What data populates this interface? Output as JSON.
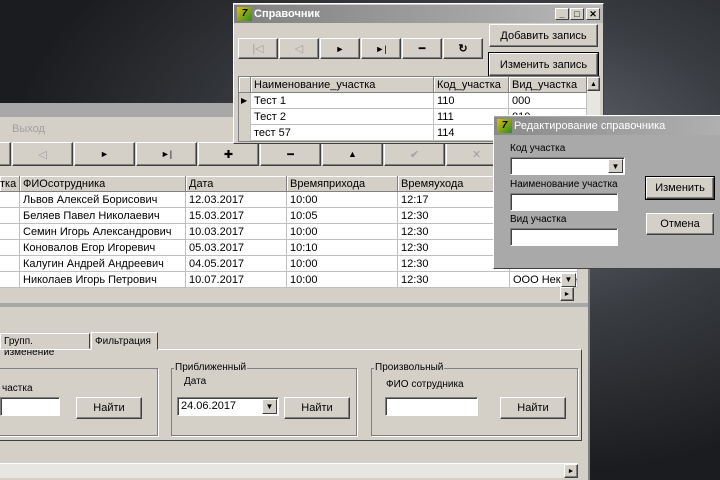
{
  "main": {
    "menu": {
      "items": [
        "Выход"
      ]
    },
    "toolbar": {
      "icons": [
        "prior-icon",
        "next-icon",
        "last-icon",
        "insert-icon",
        "delete-icon",
        "edit-icon",
        "post-icon",
        "cancel-icon"
      ],
      "glyphs": [
        "◁",
        "►",
        "►|",
        "✚",
        "━",
        "▲",
        "✔",
        "✕"
      ]
    },
    "grid": {
      "columns": [
        "тка",
        "ФИОсотрудника",
        "Дата",
        "Времяприхода",
        "Времяухода"
      ],
      "rows": [
        [
          "",
          "Львов Алексей Борисович",
          "12.03.2017",
          "10:00",
          "12:17",
          ""
        ],
        [
          "",
          "Беляев Павел Николаевич",
          "15.03.2017",
          "10:05",
          "12:30",
          ""
        ],
        [
          "",
          "Семин Игорь Александрович",
          "10.03.2017",
          "10:00",
          "12:30",
          ""
        ],
        [
          "",
          "Коновалов Егор Игоревич",
          "05.03.2017",
          "10:10",
          "12:30",
          ""
        ],
        [
          "",
          "Калугин Андрей Андреевич",
          "04.05.2017",
          "10:00",
          "12:30",
          ""
        ],
        [
          "",
          "Николаев Игорь Петрович",
          "10.07.2017",
          "10:00",
          "12:30",
          "ООО Нексон"
        ]
      ]
    },
    "tabs": [
      "Групп. изменение",
      "Фильтрация"
    ],
    "filter": {
      "exact": {
        "label": "частка",
        "value": "",
        "button": "Найти"
      },
      "approx": {
        "title": "Приближенный",
        "label": "Дата",
        "value": "24.06.2017",
        "button": "Найти"
      },
      "arbitrary": {
        "title": "Произвольный",
        "label": "ФИО сотрудника",
        "value": "",
        "button": "Найти"
      }
    }
  },
  "ref": {
    "title": "Справочник",
    "window_buttons": [
      "_",
      "□",
      "✕"
    ],
    "nav": [
      "|◁",
      "◁",
      "►",
      "►|",
      "━",
      "↻"
    ],
    "add": "Добавить запись",
    "edit": "Изменить запись",
    "columns": [
      "Наименование_участка",
      "Код_участка",
      "Вид_участка"
    ],
    "rows": [
      [
        "Тест 1",
        "110",
        "000"
      ],
      [
        "Тест 2",
        "111",
        "010"
      ],
      [
        "тест 57",
        "114",
        ""
      ]
    ]
  },
  "edit": {
    "title": "Редактирование справочника",
    "code_label": "Код участка",
    "code_value": "",
    "name_label": "Наименование участка",
    "name_value": "",
    "type_label": "Вид участка",
    "type_value": "",
    "ok": "Изменить",
    "cancel": "Отмена"
  }
}
